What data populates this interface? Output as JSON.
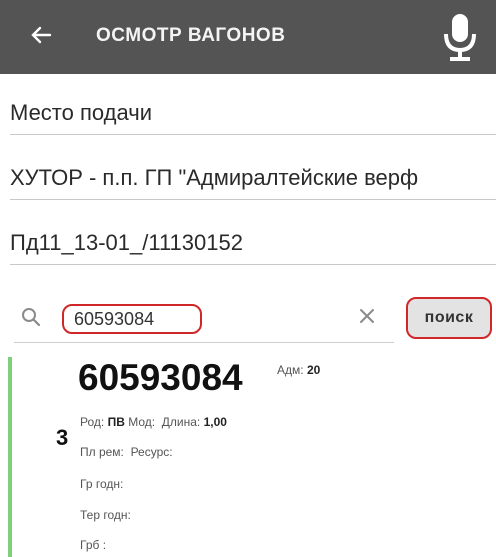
{
  "appbar": {
    "title": "ОСМОТР ВАГОНОВ",
    "back_icon": "arrow-left-icon",
    "mic_icon": "microphone-icon"
  },
  "fields": {
    "place_label": "Место подачи",
    "station": "ХУТОР - п.п. ГП \"Адмиралтейские верф",
    "doc_number": "Пд11_13-01_/11130152"
  },
  "search": {
    "value": "60593084",
    "button_label": "поиск"
  },
  "card": {
    "index": "3",
    "wagon_number": "60593084",
    "adm_label": "Адм:",
    "adm_value": "20",
    "rod_label": "Род:",
    "rod_value": "ПВ",
    "mod_label": "Мод:",
    "length_label": "Длина:",
    "length_value": "1,00",
    "plrem_label": "Пл рем:",
    "resurs_label": "Ресурс:",
    "gr_godn_label": "Гр годн:",
    "ter_godn_label": "Тер годн:",
    "grb_label": "Грб :"
  },
  "colors": {
    "appbar": "#545454",
    "highlight": "#d02828",
    "card_accent": "#7fd07a"
  }
}
